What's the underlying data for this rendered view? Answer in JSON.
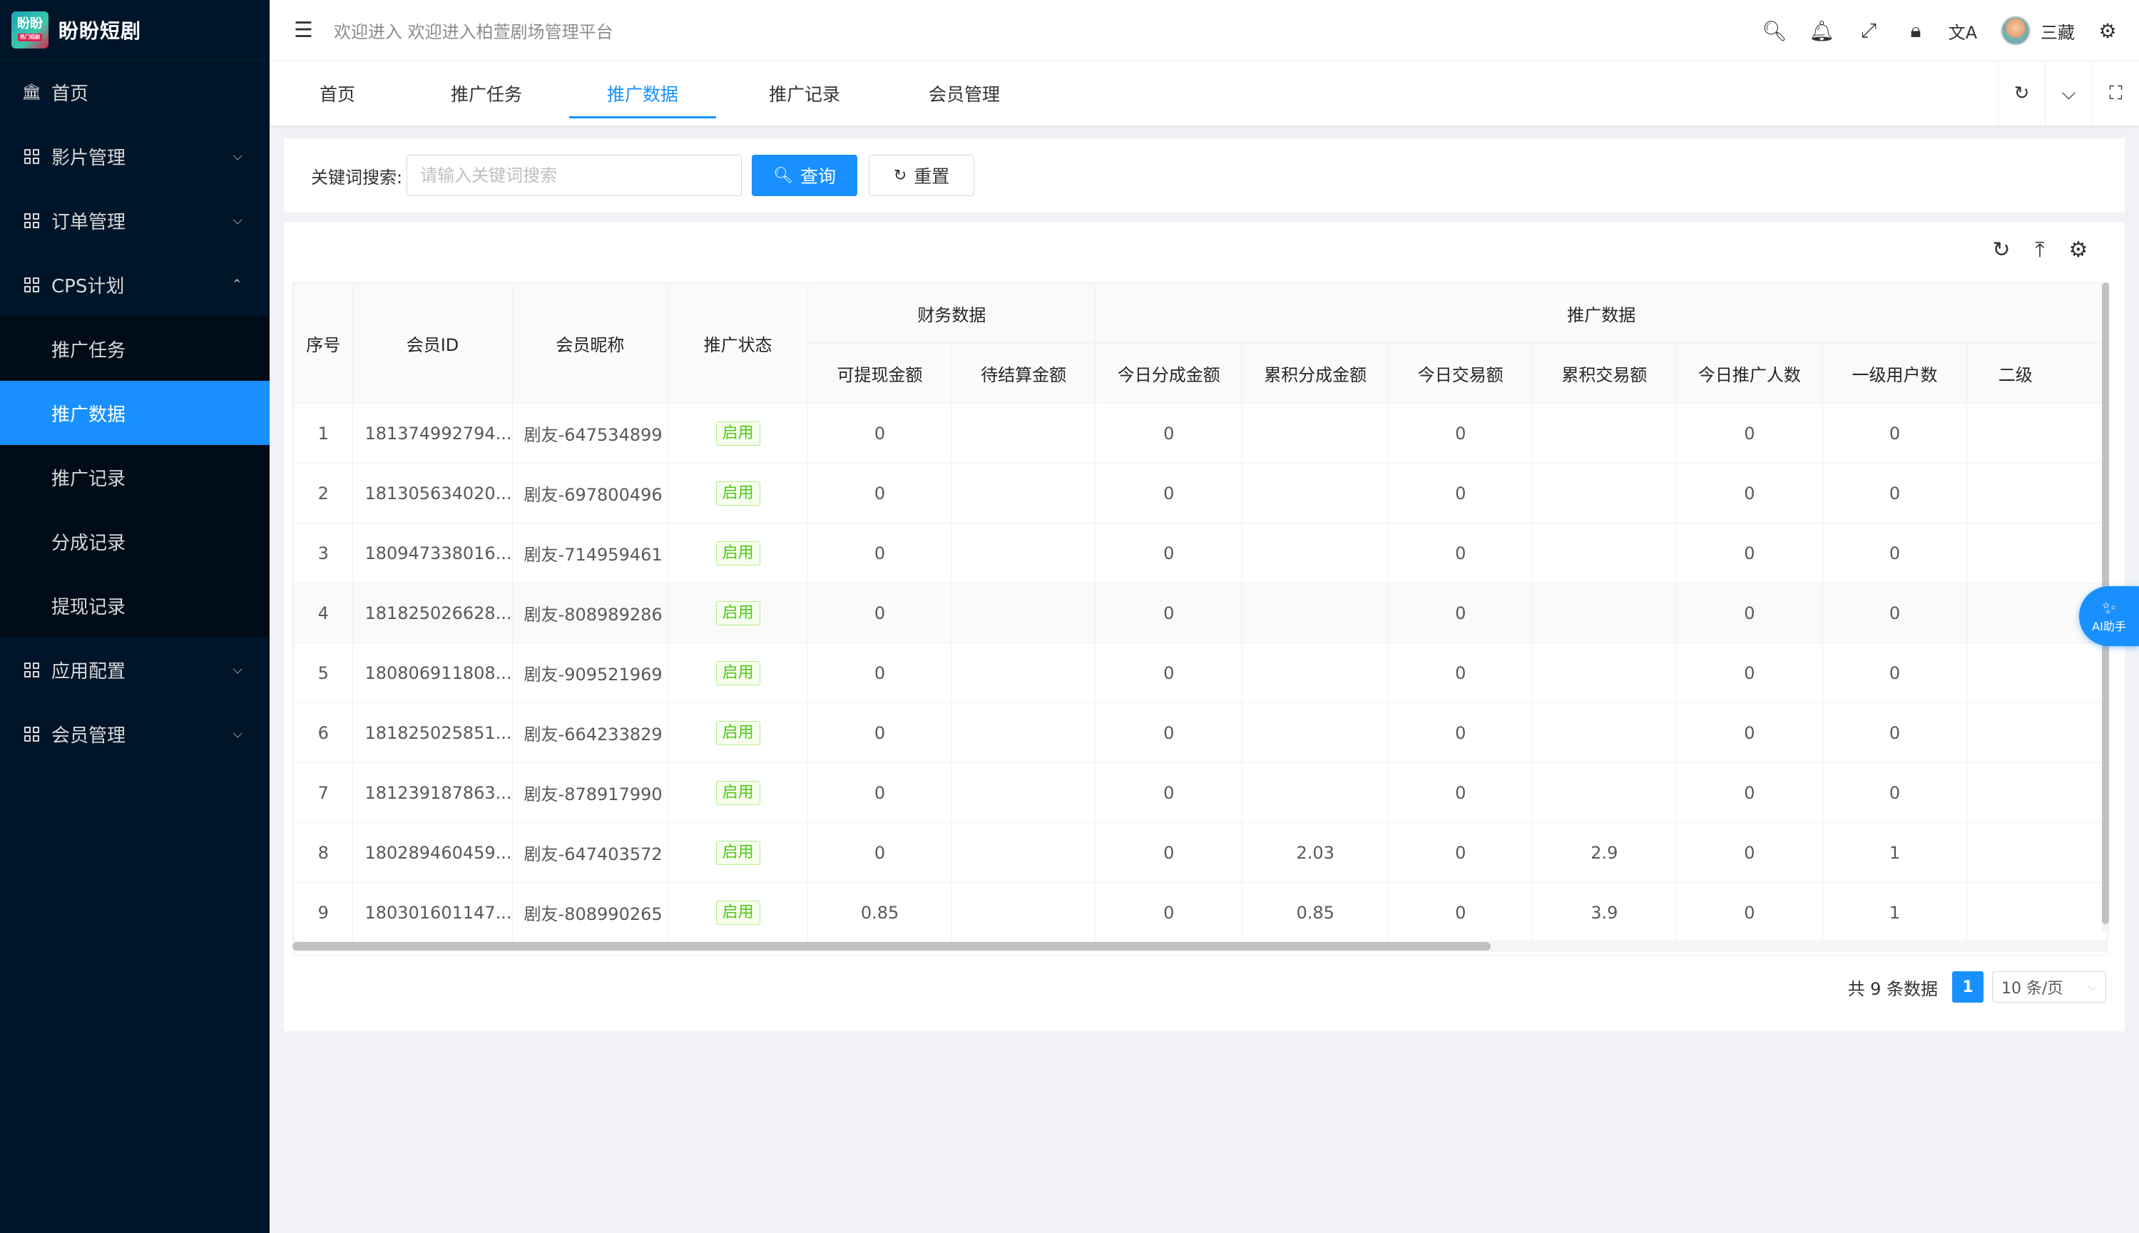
{
  "app": {
    "logo_text": "盼盼",
    "logo_sub": "热门短剧",
    "title": "盼盼短剧",
    "welcome": "欢迎进入 欢迎进入柏萱剧场管理平台",
    "username": "三藏"
  },
  "sidebar": {
    "items": [
      {
        "label": "首页",
        "icon": "bank-icon"
      },
      {
        "label": "影片管理",
        "icon": "grid-icon",
        "expanded": false
      },
      {
        "label": "订单管理",
        "icon": "grid-icon",
        "expanded": false
      },
      {
        "label": "CPS计划",
        "icon": "grid-icon",
        "expanded": true
      },
      {
        "label": "应用配置",
        "icon": "grid-icon",
        "expanded": false
      },
      {
        "label": "会员管理",
        "icon": "grid-icon",
        "expanded": false
      }
    ],
    "cps_children": [
      "推广任务",
      "推广数据",
      "推广记录",
      "分成记录",
      "提现记录"
    ],
    "active_child": "推广数据"
  },
  "tabs": [
    "首页",
    "推广任务",
    "推广数据",
    "推广记录",
    "会员管理"
  ],
  "active_tab": "推广数据",
  "search": {
    "label": "关键词搜索:",
    "placeholder": "请输入关键词搜索",
    "value": "",
    "query_label": "查询",
    "reset_label": "重置"
  },
  "table": {
    "headers": {
      "index": "序号",
      "member_id": "会员ID",
      "nickname": "会员昵称",
      "status": "推广状态",
      "group_finance": "财务数据",
      "group_promo": "推广数据",
      "withdrawable": "可提现金额",
      "pending": "待结算金额",
      "today_share": "今日分成金额",
      "total_share": "累积分成金额",
      "today_trade": "今日交易额",
      "total_trade": "累积交易额",
      "today_promo": "今日推广人数",
      "level1": "一级用户数",
      "level2": "二级"
    },
    "rows": [
      {
        "idx": "1",
        "id": "181374992794...",
        "nick": "剧友-647534899",
        "status": "启用",
        "withdrawable": "0",
        "pending": "",
        "today_share": "0",
        "total_share": "",
        "today_trade": "0",
        "total_trade": "",
        "today_promo": "0",
        "level1": "0",
        "level2": ""
      },
      {
        "idx": "2",
        "id": "181305634020...",
        "nick": "剧友-697800496",
        "status": "启用",
        "withdrawable": "0",
        "pending": "",
        "today_share": "0",
        "total_share": "",
        "today_trade": "0",
        "total_trade": "",
        "today_promo": "0",
        "level1": "0",
        "level2": ""
      },
      {
        "idx": "3",
        "id": "180947338016...",
        "nick": "剧友-714959461",
        "status": "启用",
        "withdrawable": "0",
        "pending": "",
        "today_share": "0",
        "total_share": "",
        "today_trade": "0",
        "total_trade": "",
        "today_promo": "0",
        "level1": "0",
        "level2": ""
      },
      {
        "idx": "4",
        "id": "181825026628...",
        "nick": "剧友-808989286",
        "status": "启用",
        "withdrawable": "0",
        "pending": "",
        "today_share": "0",
        "total_share": "",
        "today_trade": "0",
        "total_trade": "",
        "today_promo": "0",
        "level1": "0",
        "level2": ""
      },
      {
        "idx": "5",
        "id": "180806911808...",
        "nick": "剧友-909521969",
        "status": "启用",
        "withdrawable": "0",
        "pending": "",
        "today_share": "0",
        "total_share": "",
        "today_trade": "0",
        "total_trade": "",
        "today_promo": "0",
        "level1": "0",
        "level2": ""
      },
      {
        "idx": "6",
        "id": "181825025851...",
        "nick": "剧友-664233829",
        "status": "启用",
        "withdrawable": "0",
        "pending": "",
        "today_share": "0",
        "total_share": "",
        "today_trade": "0",
        "total_trade": "",
        "today_promo": "0",
        "level1": "0",
        "level2": ""
      },
      {
        "idx": "7",
        "id": "181239187863...",
        "nick": "剧友-878917990",
        "status": "启用",
        "withdrawable": "0",
        "pending": "",
        "today_share": "0",
        "total_share": "",
        "today_trade": "0",
        "total_trade": "",
        "today_promo": "0",
        "level1": "0",
        "level2": ""
      },
      {
        "idx": "8",
        "id": "180289460459...",
        "nick": "剧友-647403572",
        "status": "启用",
        "withdrawable": "0",
        "pending": "",
        "today_share": "0",
        "total_share": "2.03",
        "today_trade": "0",
        "total_trade": "2.9",
        "today_promo": "0",
        "level1": "1",
        "level2": ""
      },
      {
        "idx": "9",
        "id": "180301601147...",
        "nick": "剧友-808990265",
        "status": "启用",
        "withdrawable": "0.85",
        "pending": "",
        "today_share": "0",
        "total_share": "0.85",
        "today_trade": "0",
        "total_trade": "3.9",
        "today_promo": "0",
        "level1": "1",
        "level2": ""
      }
    ]
  },
  "pagination": {
    "total": "共 9 条数据",
    "current_page": "1",
    "page_size": "10 条/页"
  },
  "ai_helper": "AI助手",
  "colors": {
    "sidebar_bg": "#001529",
    "accent": "#1890ff",
    "tag_green": "#52c41a"
  }
}
